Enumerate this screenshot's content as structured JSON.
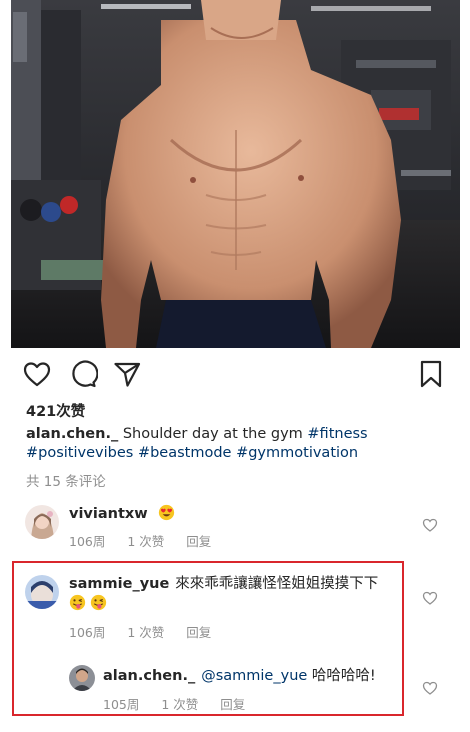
{
  "post": {
    "likes_text": "421次赞",
    "caption": {
      "username": "alan.chen._",
      "text": " Shoulder day at the gym ",
      "hashtags_line1": "#fitness",
      "hashtags_line2": [
        "#positivevibes",
        "#beastmode",
        "#gymmotivation"
      ]
    },
    "view_comments_text": "共 15 条评论"
  },
  "action_icons": [
    "heart-icon",
    "comment-icon",
    "share-icon",
    "bookmark-icon"
  ],
  "comments": [
    {
      "username": "viviantxw",
      "text": "",
      "emoji": [
        "heart-eyes-emoji"
      ],
      "age": "106周",
      "likes": "1 次赞",
      "reply": "回复"
    },
    {
      "username": "sammie_yue",
      "text": "來來乖乖讓讓怪怪姐姐摸摸下下",
      "emoji": [
        "winking-tongue-emoji",
        "winking-tongue-emoji"
      ],
      "age": "106周",
      "likes": "1 次赞",
      "reply": "回复"
    },
    {
      "username": "alan.chen._",
      "mention": "@sammie_yue",
      "text": " 哈哈哈哈!",
      "age": "105周",
      "likes": "1 次赞",
      "reply": "回复"
    }
  ],
  "colors": {
    "text": "#262626",
    "muted": "#8e8e8e",
    "link": "#003569",
    "highlight_border": "#d9262c"
  }
}
